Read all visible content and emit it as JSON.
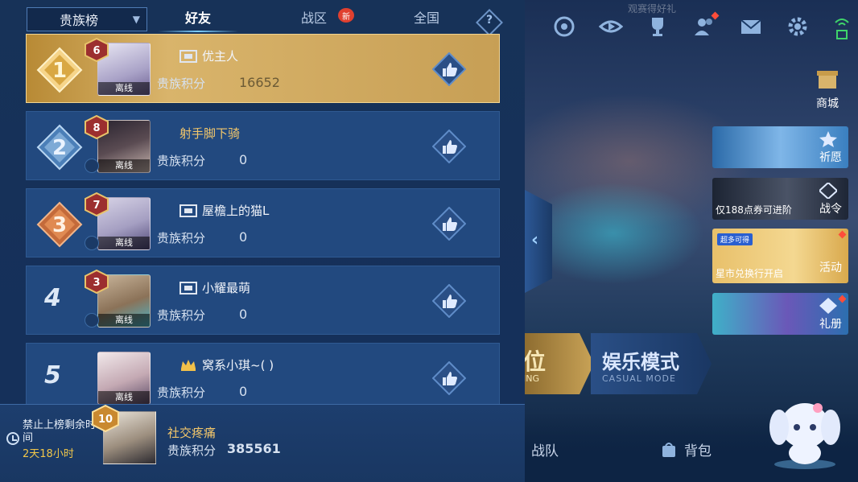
{
  "tabs": {
    "dropdown_label": "贵族榜",
    "friends": "好友",
    "zone": "战区",
    "zone_badge": "新",
    "nation": "全国",
    "help": "?"
  },
  "rows": [
    {
      "rank": "1",
      "vip": "6",
      "name": "优主人",
      "score_label": "贵族积分",
      "score": "16652",
      "status": "离线"
    },
    {
      "rank": "2",
      "vip": "8",
      "name": "射手脚下骑",
      "score_label": "贵族积分",
      "score": "0",
      "status": "离线"
    },
    {
      "rank": "3",
      "vip": "7",
      "name": "屋檐上的猫L",
      "score_label": "贵族积分",
      "score": "0",
      "status": "离线"
    },
    {
      "rank": "4",
      "vip": "3",
      "name": "小耀最萌",
      "score_label": "贵族积分",
      "score": "0",
      "status": "离线"
    },
    {
      "rank": "5",
      "vip": "SVIP",
      "name": "窝系小琪~( )",
      "score_label": "贵族积分",
      "score": "0",
      "status": "离线"
    }
  ],
  "self": {
    "ban_text": "禁止上榜剩余时间",
    "ban_time": "2天18小时",
    "vip": "10",
    "name": "社交疼痛",
    "score_label": "贵族积分",
    "score": "385561"
  },
  "right": {
    "event_banner": "观赛得好礼",
    "shop": "商城",
    "cards": [
      {
        "label_right": "祈愿",
        "label_bottom": ""
      },
      {
        "label_right": "战令",
        "label_bottom": "仅188点券可进阶"
      },
      {
        "label_right": "活动",
        "label_bottom": "星市兑换行开启",
        "tag": "超多可得"
      },
      {
        "label_right": "礼册",
        "label_bottom": ""
      }
    ],
    "mode_rank_title": "位",
    "mode_rank_sub": "ING",
    "mode_casual_title": "娱乐模式",
    "mode_casual_sub": "CASUAL MODE",
    "nav_team": "战队",
    "nav_bag": "背包"
  },
  "colors": {
    "panel_bg": "#173258",
    "row_bg": "#22497f",
    "gold": "#d9b46b",
    "accent_name": "#f2c66b"
  }
}
